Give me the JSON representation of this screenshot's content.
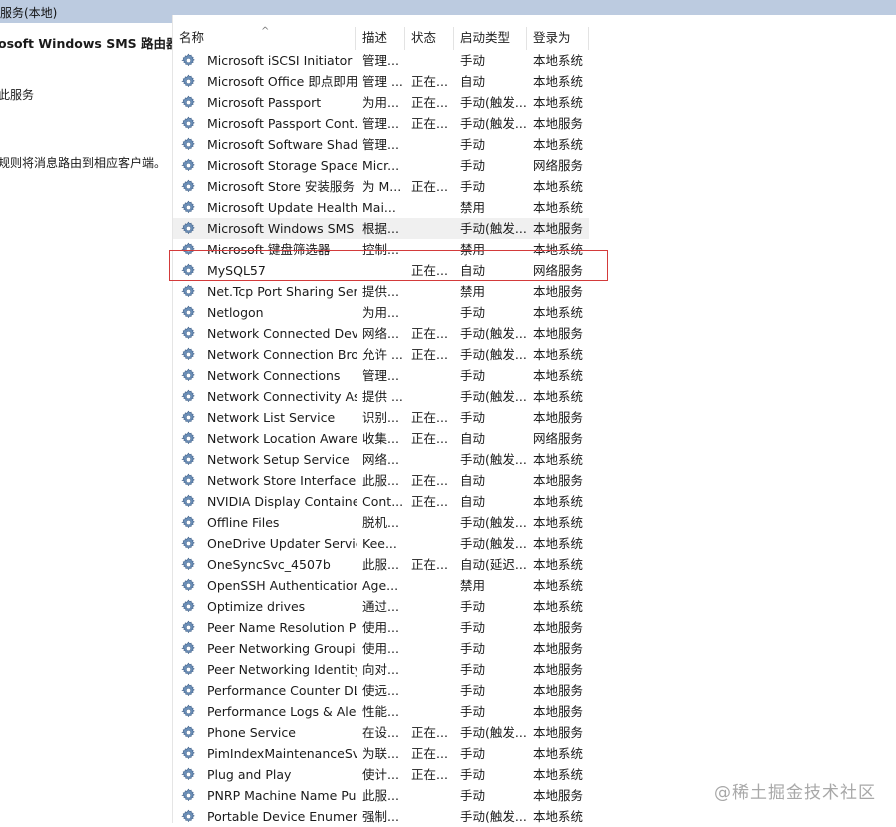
{
  "window": {
    "title": "服务(本地)"
  },
  "left_pane": {
    "service_title": "osoft Windows SMS 路由器服",
    "action_link": "此服务",
    "description_fragment": "规则将消息路由到相应客户端。"
  },
  "columns": [
    "名称",
    "描述",
    "状态",
    "启动类型",
    "登录为"
  ],
  "rows": [
    {
      "name": "Microsoft iSCSI Initiator ...",
      "desc": "管理...",
      "status": "",
      "startup": "手动",
      "logon": "本地系统"
    },
    {
      "name": "Microsoft Office 即点即用...",
      "desc": "管理 ...",
      "status": "正在...",
      "startup": "自动",
      "logon": "本地系统"
    },
    {
      "name": "Microsoft Passport",
      "desc": "为用...",
      "status": "正在...",
      "startup": "手动(触发...",
      "logon": "本地系统"
    },
    {
      "name": "Microsoft Passport Cont...",
      "desc": "管理...",
      "status": "正在...",
      "startup": "手动(触发...",
      "logon": "本地服务"
    },
    {
      "name": "Microsoft Software Shad...",
      "desc": "管理...",
      "status": "",
      "startup": "手动",
      "logon": "本地系统"
    },
    {
      "name": "Microsoft Storage Space...",
      "desc": "Micr...",
      "status": "",
      "startup": "手动",
      "logon": "网络服务"
    },
    {
      "name": "Microsoft Store 安装服务",
      "desc": "为 M...",
      "status": "正在...",
      "startup": "手动",
      "logon": "本地系统"
    },
    {
      "name": "Microsoft Update Health...",
      "desc": "Mai...",
      "status": "",
      "startup": "禁用",
      "logon": "本地系统"
    },
    {
      "name": "Microsoft Windows SMS ...",
      "desc": "根据...",
      "status": "",
      "startup": "手动(触发...",
      "logon": "本地服务"
    },
    {
      "name": "Microsoft 键盘筛选器",
      "desc": "控制...",
      "status": "",
      "startup": "禁用",
      "logon": "本地系统"
    },
    {
      "name": "MySQL57",
      "desc": "",
      "status": "正在...",
      "startup": "自动",
      "logon": "网络服务"
    },
    {
      "name": "Net.Tcp Port Sharing Ser...",
      "desc": "提供...",
      "status": "",
      "startup": "禁用",
      "logon": "本地服务"
    },
    {
      "name": "Netlogon",
      "desc": "为用...",
      "status": "",
      "startup": "手动",
      "logon": "本地系统"
    },
    {
      "name": "Network Connected Devi...",
      "desc": "网络...",
      "status": "正在...",
      "startup": "手动(触发...",
      "logon": "本地服务"
    },
    {
      "name": "Network Connection Bro...",
      "desc": "允许 ...",
      "status": "正在...",
      "startup": "手动(触发...",
      "logon": "本地系统"
    },
    {
      "name": "Network Connections",
      "desc": "管理...",
      "status": "",
      "startup": "手动",
      "logon": "本地系统"
    },
    {
      "name": "Network Connectivity Ass...",
      "desc": "提供 ...",
      "status": "",
      "startup": "手动(触发...",
      "logon": "本地系统"
    },
    {
      "name": "Network List Service",
      "desc": "识别...",
      "status": "正在...",
      "startup": "手动",
      "logon": "本地服务"
    },
    {
      "name": "Network Location Aware...",
      "desc": "收集...",
      "status": "正在...",
      "startup": "自动",
      "logon": "网络服务"
    },
    {
      "name": "Network Setup Service",
      "desc": "网络...",
      "status": "",
      "startup": "手动(触发...",
      "logon": "本地系统"
    },
    {
      "name": "Network Store Interface ...",
      "desc": "此服...",
      "status": "正在...",
      "startup": "自动",
      "logon": "本地服务"
    },
    {
      "name": "NVIDIA Display Containe...",
      "desc": "Cont...",
      "status": "正在...",
      "startup": "自动",
      "logon": "本地系统"
    },
    {
      "name": "Offline Files",
      "desc": "脱机...",
      "status": "",
      "startup": "手动(触发...",
      "logon": "本地系统"
    },
    {
      "name": "OneDrive Updater Service",
      "desc": "Kee...",
      "status": "",
      "startup": "手动(触发...",
      "logon": "本地系统"
    },
    {
      "name": "OneSyncSvc_4507b",
      "desc": "此服...",
      "status": "正在...",
      "startup": "自动(延迟...",
      "logon": "本地系统"
    },
    {
      "name": "OpenSSH Authentication ...",
      "desc": "Age...",
      "status": "",
      "startup": "禁用",
      "logon": "本地系统"
    },
    {
      "name": "Optimize drives",
      "desc": "通过...",
      "status": "",
      "startup": "手动",
      "logon": "本地系统"
    },
    {
      "name": "Peer Name Resolution Pr...",
      "desc": "使用...",
      "status": "",
      "startup": "手动",
      "logon": "本地服务"
    },
    {
      "name": "Peer Networking Groupi...",
      "desc": "使用...",
      "status": "",
      "startup": "手动",
      "logon": "本地服务"
    },
    {
      "name": "Peer Networking Identity...",
      "desc": "向对...",
      "status": "",
      "startup": "手动",
      "logon": "本地服务"
    },
    {
      "name": "Performance Counter DL...",
      "desc": "使远...",
      "status": "",
      "startup": "手动",
      "logon": "本地服务"
    },
    {
      "name": "Performance Logs & Aler...",
      "desc": "性能...",
      "status": "",
      "startup": "手动",
      "logon": "本地服务"
    },
    {
      "name": "Phone Service",
      "desc": "在设...",
      "status": "正在...",
      "startup": "手动(触发...",
      "logon": "本地服务"
    },
    {
      "name": "PimIndexMaintenanceSvc...",
      "desc": "为联...",
      "status": "正在...",
      "startup": "手动",
      "logon": "本地系统"
    },
    {
      "name": "Plug and Play",
      "desc": "使计...",
      "status": "正在...",
      "startup": "手动",
      "logon": "本地系统"
    },
    {
      "name": "PNRP Machine Name Pu...",
      "desc": "此服...",
      "status": "",
      "startup": "手动",
      "logon": "本地服务"
    },
    {
      "name": "Portable Device Enumera...",
      "desc": "强制...",
      "status": "",
      "startup": "手动(触发...",
      "logon": "本地系统"
    }
  ],
  "selected_row_index": 8,
  "highlighted_row_index": 10,
  "watermark": "@稀土掘金技术社区",
  "colors": {
    "titlebar": "#bccbe0",
    "highlight_border": "#d33a3a",
    "selection": "#f0f0f0"
  },
  "icons": {
    "service": "gear-icon",
    "sort": "sort-up-icon"
  }
}
